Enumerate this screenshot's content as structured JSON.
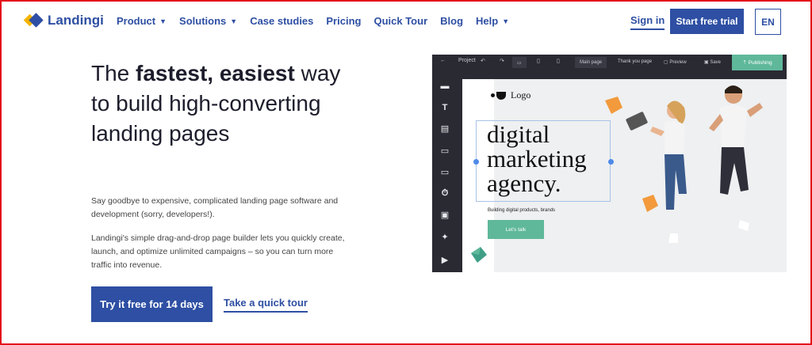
{
  "brand": {
    "name": "Landingi"
  },
  "nav": {
    "items": [
      {
        "label": "Product",
        "dropdown": true
      },
      {
        "label": "Solutions",
        "dropdown": true
      },
      {
        "label": "Case studies",
        "dropdown": false
      },
      {
        "label": "Pricing",
        "dropdown": false
      },
      {
        "label": "Quick Tour",
        "dropdown": false
      },
      {
        "label": "Blog",
        "dropdown": false
      },
      {
        "label": "Help",
        "dropdown": true
      }
    ],
    "sign_in": "Sign in",
    "start_trial": "Start free trial",
    "language": "EN"
  },
  "hero": {
    "title_pre": "The ",
    "title_bold": "fastest, easiest",
    "title_post": " way to build high-converting landing pages",
    "desc1": "Say goodbye to expensive, complicated landing page software and development (sorry, developers!).",
    "desc2": "Landingi's simple drag-and-drop page builder lets you quickly create, launch, and optimize unlimited campaigns – so you can turn more traffic into revenue.",
    "cta": "Try it free for 14 days",
    "tour": "Take a quick tour"
  },
  "editor": {
    "project": "Project",
    "main_page": "Main page",
    "thank_you": "Thank you page",
    "preview": "Preview",
    "save": "Save",
    "publish": "Publishing",
    "canvas": {
      "logo": "Logo",
      "headline_1": "digital",
      "headline_2": "marketing",
      "headline_3": "agency.",
      "subline": "Building digital products, brands",
      "button": "Let's talk"
    }
  },
  "colors": {
    "brand": "#2e4fa3",
    "accent": "#5fb89a",
    "frame": "#e3131b"
  }
}
